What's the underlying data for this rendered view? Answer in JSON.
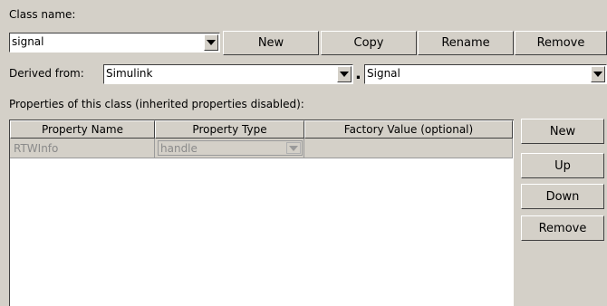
{
  "class_name_label": "Class name:",
  "class_name_value": "signal",
  "top_buttons": {
    "new": "New",
    "copy": "Copy",
    "rename": "Rename",
    "remove": "Remove"
  },
  "derived_from_label": "Derived from:",
  "derived_package": "Simulink",
  "dot_separator": ".",
  "derived_class": "Signal",
  "properties_label": "Properties of this class (inherited properties disabled):",
  "table": {
    "headers": [
      "Property Name",
      "Property Type",
      "Factory Value (optional)"
    ],
    "rows": [
      {
        "name": "RTWInfo",
        "type": "handle",
        "factory_value": ""
      }
    ]
  },
  "side_buttons": {
    "new": "New",
    "up": "Up",
    "down": "Down",
    "remove": "Remove"
  }
}
